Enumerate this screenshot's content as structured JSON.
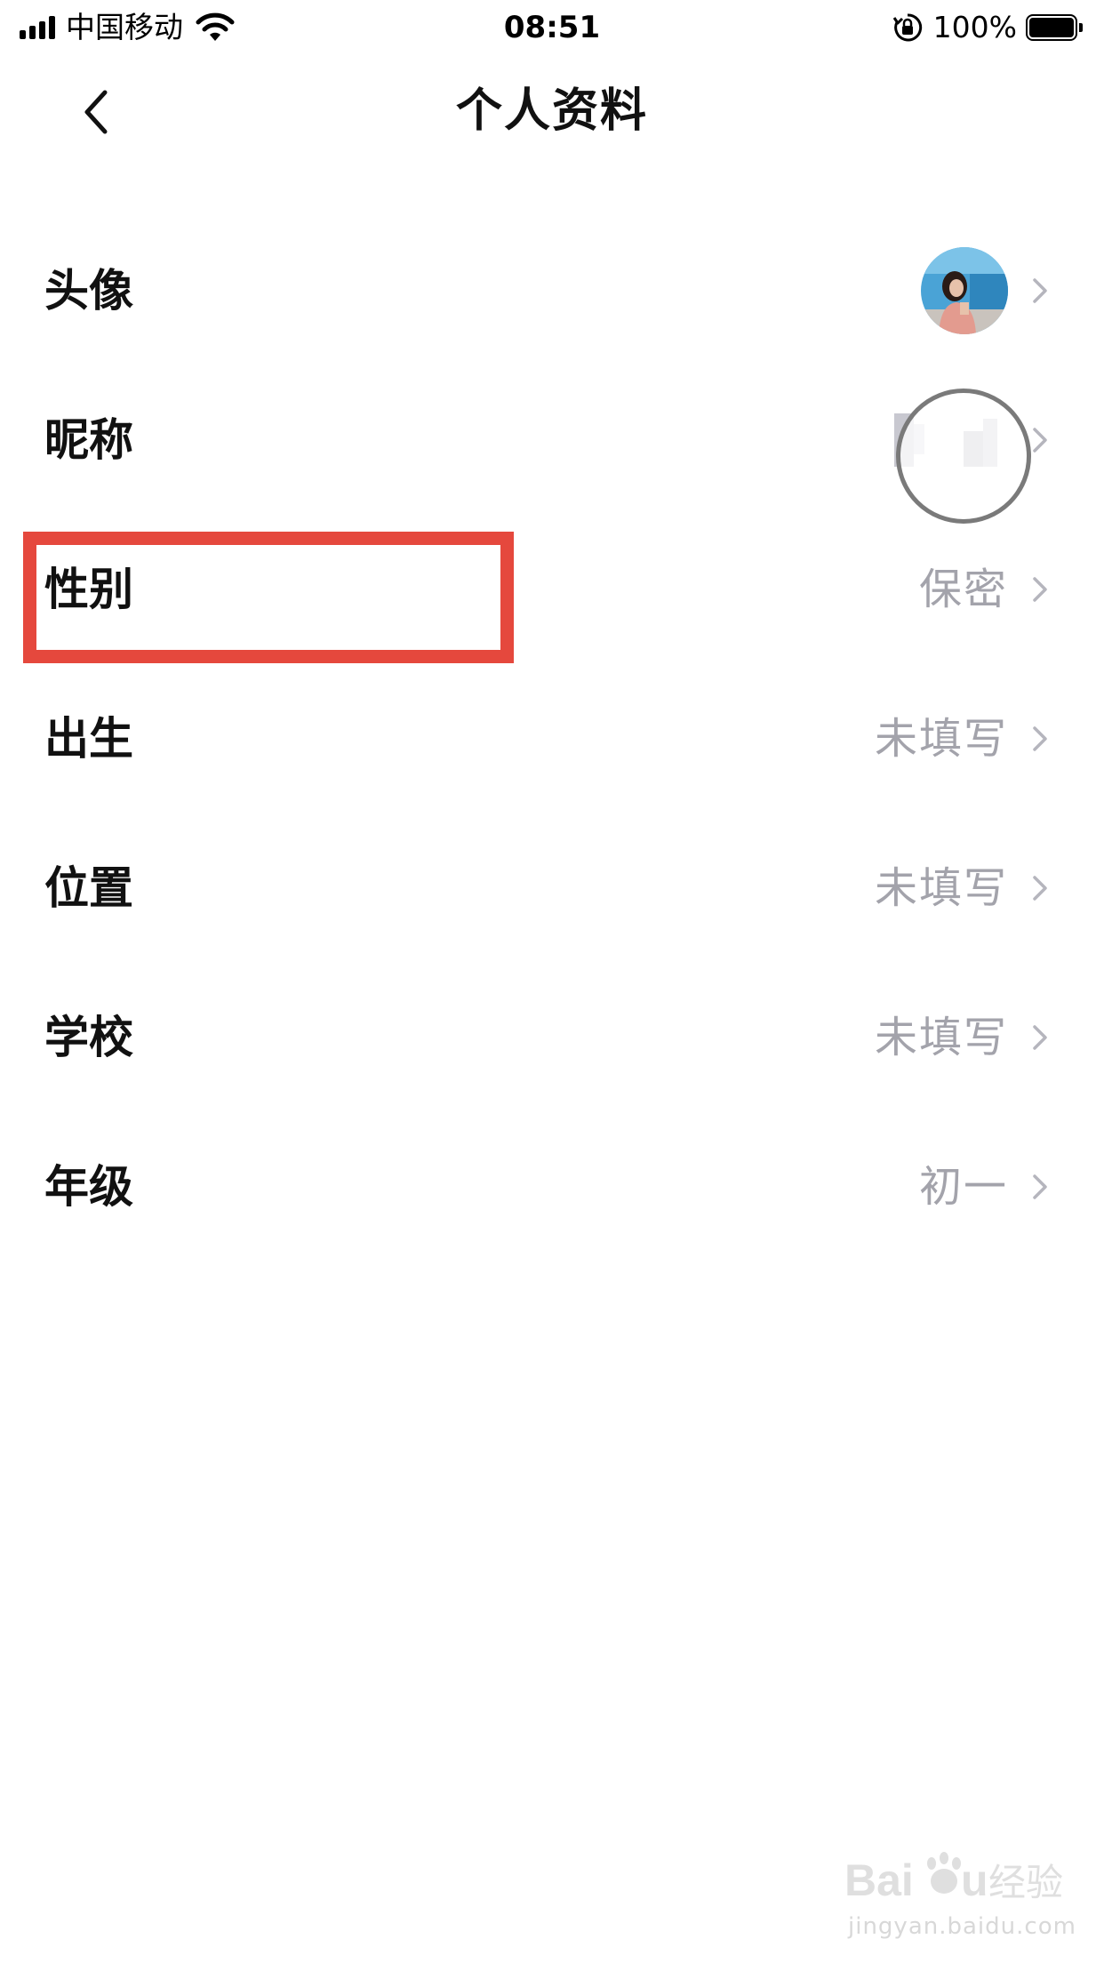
{
  "status_bar": {
    "carrier": "中国移动",
    "time": "08:51",
    "battery": "100%",
    "icons": [
      "signal-icon",
      "wifi-icon",
      "orientation-lock-icon",
      "battery-icon"
    ]
  },
  "header": {
    "title": "个人资料",
    "back_icon": "back-arrow-icon"
  },
  "profile_rows": [
    {
      "label": "头像",
      "value": "",
      "kind": "avatar"
    },
    {
      "label": "昵称",
      "value": "",
      "kind": "nickname"
    },
    {
      "label": "性别",
      "value": "保密",
      "kind": "text"
    },
    {
      "label": "出生",
      "value": "未填写",
      "kind": "text"
    },
    {
      "label": "位置",
      "value": "未填写",
      "kind": "text"
    },
    {
      "label": "学校",
      "value": "未填写",
      "kind": "text"
    },
    {
      "label": "年级",
      "value": "初一",
      "kind": "text"
    }
  ],
  "annotation": {
    "highlight_color": "#e5483d",
    "highlighted_row": "性别"
  },
  "colors": {
    "background": "#ffffff",
    "label": "#111111",
    "value": "#a3a3ab",
    "chevron": "#b5b5bd"
  },
  "watermark": {
    "logo": "Baidu经验",
    "url": "jingyan.baidu.com"
  }
}
